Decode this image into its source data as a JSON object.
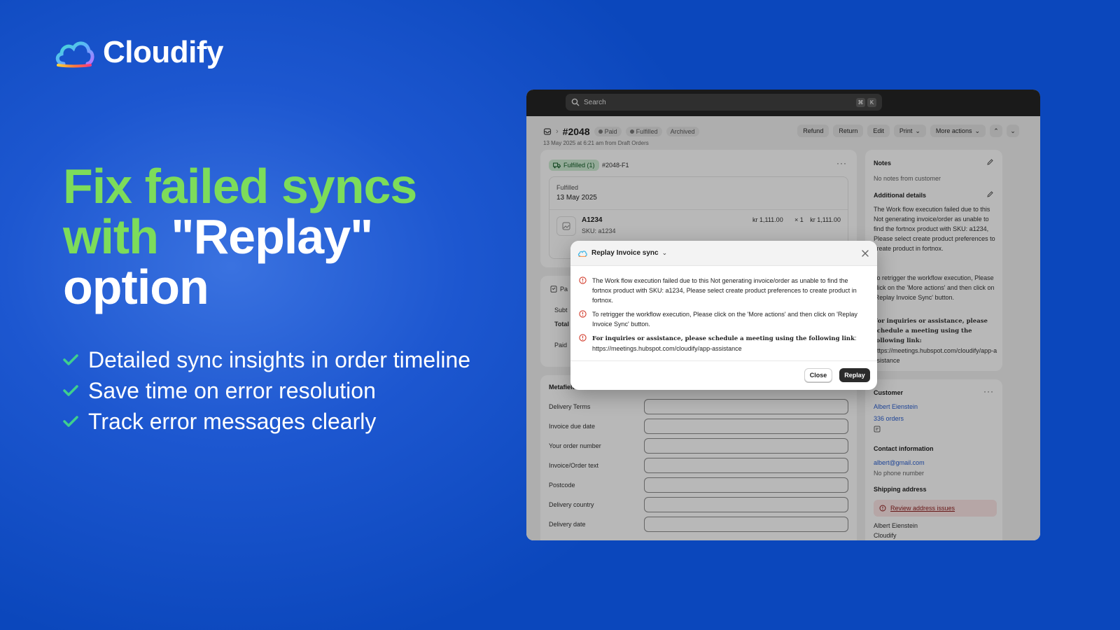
{
  "brand": {
    "name": "Cloudify"
  },
  "headline": {
    "line1": "Fix failed syncs",
    "line2_green": "with ",
    "line2_white": "\"Replay\"",
    "line3": "option"
  },
  "features": [
    "Detailed sync insights in order timeline",
    "Save time on error resolution",
    "Track error messages clearly"
  ],
  "app": {
    "search": {
      "placeholder": "Search",
      "key1": "⌘",
      "key2": "K"
    },
    "order": {
      "number": "#2048",
      "badges": [
        "Paid",
        "Fulfilled",
        "Archived"
      ],
      "subtitle": "13 May 2025 at 6:21 am from Draft Orders"
    },
    "actions": [
      "Refund",
      "Return",
      "Edit",
      "Print",
      "More actions"
    ],
    "fulfillment": {
      "tag": "Fulfilled (1)",
      "id": "#2048-F1",
      "label": "Fulfilled",
      "date": "13 May 2025",
      "product": "A1234",
      "sku": "SKU: a1234",
      "price": "kr 1,111.00",
      "qty": "×   1",
      "total": "kr 1,111.00"
    },
    "payment": {
      "title": "Pa",
      "sub": "Subt",
      "total": "Total",
      "paid": "Paid"
    },
    "metafields": {
      "title": "Metafields",
      "rows": [
        "Delivery Terms",
        "Invoice due date",
        "Your order number",
        "Invoice/Order text",
        "Postcode",
        "Delivery country",
        "Delivery date"
      ]
    },
    "notes": {
      "title": "Notes",
      "empty": "No notes from customer",
      "details_title": "Additional details",
      "details_p1": "The Work flow execution failed due to this Not generating invoice/order as unable to find the fortnox product with SKU: a1234, Please select create product preferences to create product in fortnox.",
      "details_p2": "To retrigger the workflow execution, Please click on the 'More actions' and then click on 'Replay Invoice Sync' button.",
      "details_p3": "For inquiries or assistance, please schedule a meeting using the following link:",
      "details_link": "https://meetings.hubspot.com/cloudify/app-assistance"
    },
    "customer": {
      "title": "Customer",
      "name": "Albert Eienstein",
      "orders": "336 orders",
      "contact_title": "Contact information",
      "email": "albert@gmail.com",
      "phone": "No phone number",
      "shipping_title": "Shipping address",
      "review": "Review address issues",
      "ship_name": "Albert Eienstein",
      "ship_line2": "Cloudify"
    }
  },
  "modal": {
    "title": "Replay Invoice sync",
    "messages": [
      "The Work flow execution failed due to this Not generating invoice/order as unable to find the fortnox product with SKU: a1234, Please select create product preferences to create product in fortnox.",
      "To retrigger the workflow execution, Please click on the 'More actions' and then click on 'Replay Invoice Sync' button."
    ],
    "inquiry_bold": "For inquiries or assistance, please schedule a meeting using the following link",
    "inquiry_link": "https://meetings.hubspot.com/cloudify/app-assistance",
    "close_label": "Close",
    "replay_label": "Replay"
  },
  "colors": {
    "background": "#0b47bc",
    "accent_green": "#7ddc5a",
    "primary_button": "#2b2b2b"
  }
}
